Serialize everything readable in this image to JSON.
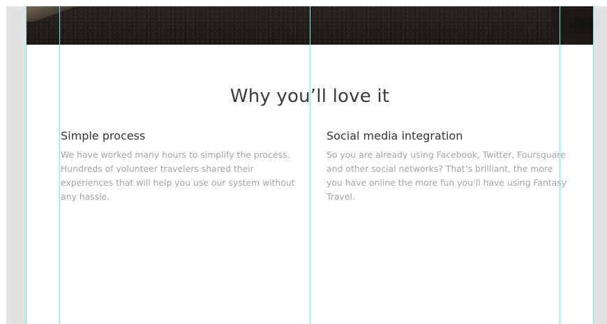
{
  "section": {
    "title": "Why you’ll love it"
  },
  "features": [
    {
      "title": "Simple process",
      "body": "We have worked many hours to simplify the process. Hundreds of volunteer travelers shared their experiences that will help you use our system without any hassle."
    },
    {
      "title": "Social media integration",
      "body": "So you are already using Facebook, Twitter, Foursquare and other social networks? That’s brilliant, the more you have online the more fun you’ll have using Fantasy Travel."
    }
  ],
  "colors": {
    "guide": "#7fe9ee",
    "heading": "#3a3a3a",
    "body_text": "#a3a3a3",
    "canvas_bg": "#e2e2e2"
  }
}
